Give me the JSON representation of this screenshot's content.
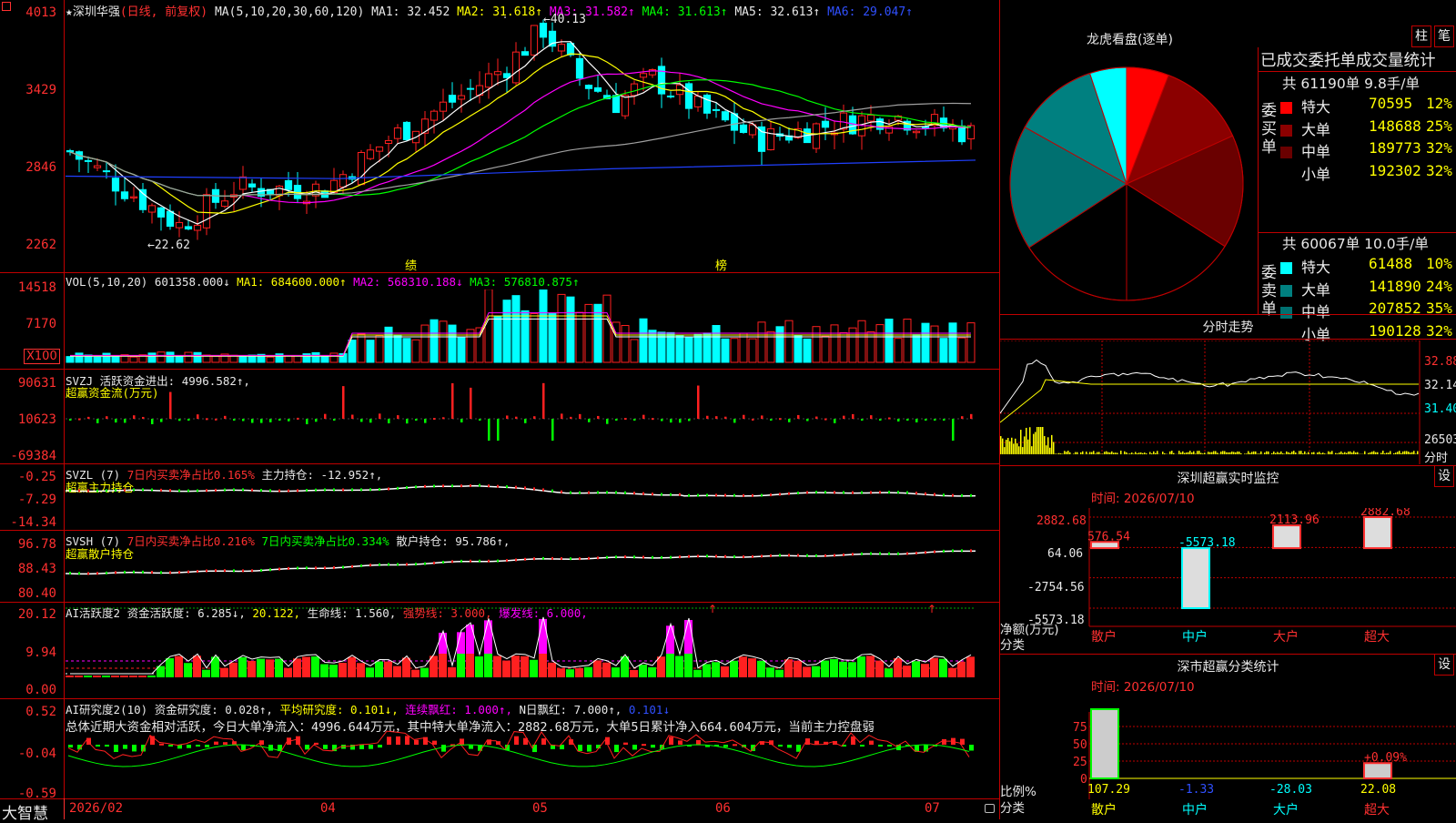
{
  "brand": "大智慧",
  "stock": {
    "name": "★深圳华强",
    "mode": "(日线, 前复权)"
  },
  "kline": {
    "header": {
      "ma_label": "MA(5,10,20,30,60,120)",
      "ma1": "MA1: 32.452",
      "ma2": "MA2: 31.618↑",
      "ma3": "MA3: 31.582↑",
      "ma4": "MA4: 31.613↑",
      "ma5": "MA5: 32.613↑",
      "ma6": "MA6: 29.047↑"
    },
    "yticks": [
      "4013",
      "3429",
      "2846",
      "2262"
    ],
    "low_mark": "←22.62",
    "high_mark": "←40.13",
    "events": [
      "绩",
      "榜"
    ],
    "colors": {
      "up": "#ff2020",
      "down": "#00ffff",
      "ma1": "#ffffff",
      "ma2": "#ffff00",
      "ma3": "#ff00ff",
      "ma4": "#00ff00",
      "ma5": "#a0a0a0",
      "ma6": "#2040ff"
    }
  },
  "vol": {
    "header_label": "VOL(5,10,20)",
    "value": "601358.000↓",
    "ma1": "MA1: 684600.000↑",
    "ma2": "MA2: 568310.188↓",
    "ma3": "MA3: 576810.875↑",
    "yticks": [
      "14518",
      "7170"
    ],
    "unit": "X100"
  },
  "svzj": {
    "line1_label": "SVZJ",
    "line1": "活跃资金进出: 4996.582↑,",
    "line2": "超赢资金流(万元)",
    "yticks": [
      "90631",
      "10623",
      "-69384"
    ]
  },
  "svzl": {
    "label": "SVZL (7)",
    "p1": "7日内买卖净占比0.165%",
    "p2": "主力持仓: -12.952↑,",
    "line2": "超赢主力持仓",
    "yticks": [
      "-0.25",
      "-7.29",
      "-14.34"
    ]
  },
  "svsh": {
    "label": "SVSH (7)",
    "p1": "7日内买卖净占比0.216%",
    "p2": "7日内买卖净占比0.334%",
    "p3": "散户持仓: 95.786↑,",
    "line2": "超赢散户持仓",
    "yticks": [
      "96.78",
      "88.43",
      "80.40"
    ]
  },
  "ai2": {
    "label": "AI活跃度2",
    "p1": "资金活跃度: 6.285↓,",
    "p2": "20.122,",
    "p3": "生命线: 1.560,",
    "p4": "强势线: 3.000,",
    "p5": "爆发线: 6.000,",
    "yticks": [
      "20.12",
      "9.94",
      "0.00"
    ]
  },
  "ai_research": {
    "label": "AI研究度2(10)",
    "p1": "资金研究度: 0.028↑,",
    "p2": "平均研究度: 0.101↓,",
    "p3": "连续飘红: 1.000↑,",
    "p4": "N日飘红: 7.000↑,",
    "p5": "0.101↓",
    "summary": "总体近期大资金相对活跃，今日大单净流入：4996.644万元，其中特大单净流入：2882.68万元，大单5日累计净入664.604万元，当前主力控盘弱",
    "yticks": [
      "0.52",
      "-0.04",
      "-0.59"
    ]
  },
  "xaxis": [
    "2026/02",
    "04",
    "05",
    "06",
    "07"
  ],
  "dragon": {
    "title": "龙虎看盘(逐单)",
    "btn1": "柱",
    "btn2": "笔",
    "stat_title": "已成交委托单成交量统计",
    "buy": {
      "side": "委买单",
      "summary": "共 61190单 9.8手/单",
      "rows": [
        {
          "label": "特大",
          "value": "70595",
          "pct": "12%",
          "color": "#ff0000"
        },
        {
          "label": "大单",
          "value": "148688",
          "pct": "25%",
          "color": "#8b0000"
        },
        {
          "label": "中单",
          "value": "189773",
          "pct": "32%",
          "color": "#6a0000"
        },
        {
          "label": "小单",
          "value": "192302",
          "pct": "32%",
          "color": "#000000"
        }
      ]
    },
    "sell": {
      "side": "委卖单",
      "summary": "共 60067单 10.0手/单",
      "rows": [
        {
          "label": "特大",
          "value": "61488",
          "pct": "10%",
          "color": "#00ffff"
        },
        {
          "label": "大单",
          "value": "141890",
          "pct": "24%",
          "color": "#008080"
        },
        {
          "label": "中单",
          "value": "207852",
          "pct": "35%",
          "color": "#007070"
        },
        {
          "label": "小单",
          "value": "190128",
          "pct": "32%",
          "color": "#000000"
        }
      ]
    }
  },
  "intraday": {
    "title": "分时走势",
    "yticks": [
      "32.88",
      "32.14",
      "31.40",
      "26503"
    ],
    "unit": "分时"
  },
  "monitor": {
    "title": "深圳超赢实时监控",
    "btn": "设",
    "time": "时间: 2026/07/10",
    "yticks": [
      "2882.68",
      "64.06",
      "-2754.56",
      "-5573.18"
    ],
    "ylabel": "净额(万元)",
    "xlabel": "分类",
    "bars": [
      {
        "name": "散户",
        "value": "576.54"
      },
      {
        "name": "中户",
        "value": "-5573.18"
      },
      {
        "name": "大户",
        "value": "2113.96"
      },
      {
        "name": "超大",
        "value": "2882.68"
      }
    ]
  },
  "classify": {
    "title": "深市超赢分类统计",
    "btn": "设",
    "time": "时间: 2026/07/10",
    "yticks": [
      "75",
      "50",
      "25",
      "0"
    ],
    "ylabel": "比例%",
    "xlabel": "分类",
    "bars": [
      {
        "name": "散户",
        "value": "107.29"
      },
      {
        "name": "中户",
        "value": "-1.33"
      },
      {
        "name": "大户",
        "value": "-28.03"
      },
      {
        "name": "超大",
        "value": "22.08"
      }
    ],
    "note": "+0.09%"
  },
  "chart_data": {
    "type": "pie",
    "title": "龙虎看盘(逐单)",
    "categories": [
      "委买特大",
      "委买大单",
      "委买中单",
      "委买小单",
      "委卖小单",
      "委卖中单",
      "委卖大单",
      "委卖特大"
    ],
    "values": [
      70595,
      148688,
      189773,
      192302,
      190128,
      207852,
      141890,
      61488
    ],
    "colors": [
      "#ff0000",
      "#8b0000",
      "#6a0000",
      "#000000",
      "#000000",
      "#007070",
      "#008080",
      "#00ffff"
    ]
  }
}
